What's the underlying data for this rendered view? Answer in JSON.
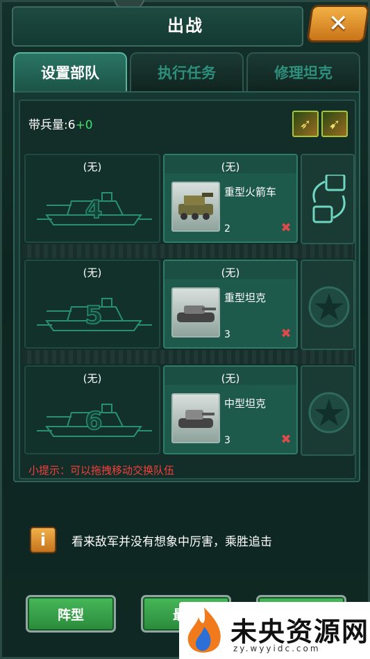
{
  "title": "出战",
  "close_label": "✕",
  "tabs": [
    {
      "label": "设置部队",
      "active": true
    },
    {
      "label": "执行任务",
      "active": false
    },
    {
      "label": "修理坦克",
      "active": false
    }
  ],
  "troop": {
    "label": "带兵量:",
    "base": "6",
    "bonus": "+0"
  },
  "buffs": [
    "rocket-buff-icon",
    "missile-buff-icon"
  ],
  "rows": [
    {
      "empty_label": "(无)",
      "slot_number": "4",
      "unit_label": "(无)",
      "unit_name": "重型火箭车",
      "unit_count": "2",
      "side": "swap-icon"
    },
    {
      "empty_label": "(无)",
      "slot_number": "5",
      "unit_label": "(无)",
      "unit_name": "重型坦克",
      "unit_count": "3",
      "side": "star-icon"
    },
    {
      "empty_label": "(无)",
      "slot_number": "6",
      "unit_label": "(无)",
      "unit_name": "中型坦克",
      "unit_count": "3",
      "side": "star-icon"
    }
  ],
  "remove_glyph": "✖",
  "tip": "小提示：可以拖拽移动交换队伍",
  "info": {
    "icon": "i",
    "text": "看来敌军并没有想象中厉害，乘胜追击"
  },
  "buttons": [
    "阵型",
    "最大",
    ""
  ],
  "watermark": {
    "text": "未央资源网",
    "url": "zy.wyyidc.com"
  },
  "colors": {
    "accent": "#2a7564",
    "danger": "#e14a4a",
    "button": "#3aa84c",
    "warning": "#f2413c"
  }
}
